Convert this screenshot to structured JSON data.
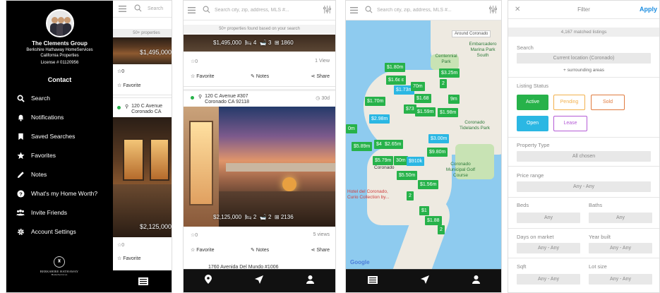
{
  "panel1": {
    "agent_name": "The Clements Group",
    "agent_sub1": "Berkshire Hathaway HomeServices",
    "agent_sub2": "California Properties",
    "license": "License # 01120956",
    "contact_label": "Contact",
    "menu_items": [
      {
        "label": "Search",
        "icon": "search-icon"
      },
      {
        "label": "Notifications",
        "icon": "bell-icon"
      },
      {
        "label": "Saved Searches",
        "icon": "bookmark-icon"
      },
      {
        "label": "Favorites",
        "icon": "star-icon"
      },
      {
        "label": "Notes",
        "icon": "pencil-icon"
      },
      {
        "label": "What's my Home Worth?",
        "icon": "question-icon"
      },
      {
        "label": "Invite Friends",
        "icon": "people-icon"
      },
      {
        "label": "Account Settings",
        "icon": "gear-icon"
      }
    ],
    "logo_text": "BERKSHIRE HATHAWAY",
    "logo_sub": "HomeServices",
    "search_placeholder": "Search",
    "found_text": "50+ properties",
    "price_top": "$1,495,000",
    "favorite_count": "0",
    "favorite_label": "Favorite",
    "address_line1": "120 C Avenue",
    "address_line2": "Coronado CA",
    "price_mid": "$2,125,000",
    "favorite_count2": "0",
    "favorite_label2": "Favorite"
  },
  "panel2": {
    "search_placeholder": "Search city, zip, address, MLS #...",
    "found_text": "50+ properties found based on your search",
    "listing1": {
      "price": "$1,495,000",
      "beds": "4",
      "baths": "3",
      "sqft": "1860",
      "favorites": "0",
      "views": "1 View"
    },
    "actions": {
      "favorite": "Favorite",
      "notes": "Notes",
      "share": "Share"
    },
    "listing2": {
      "address_line1": "120 C Avenue #307",
      "address_line2": "Coronado CA 92118",
      "days": "30d",
      "price": "$2,125,000",
      "beds": "2",
      "baths": "2",
      "sqft": "2136",
      "favorites": "0",
      "views": "5 views"
    },
    "listing3_address": "1760 Avenida Del Mundo #1006"
  },
  "panel3": {
    "search_placeholder": "Search city, zip, address, MLS #...",
    "around_label": "Around Coronado",
    "place_labels": [
      "Embarcadero Marina Park South",
      "Centennial Park",
      "Coronado Tidelands Park",
      "Coronado",
      "Coronado Municipal Golf Course",
      "Hotel del Coronado, Curio Collection by..."
    ],
    "markers": [
      {
        "label": "$1.80m",
        "color": "green"
      },
      {
        "label": "$1.6ɛ ɛ",
        "color": "green"
      },
      {
        "label": "$3.25m",
        "color": "green"
      },
      {
        "label": "$1.73m",
        "color": "blue"
      },
      {
        "label": "70m",
        "color": "green"
      },
      {
        "label": "2",
        "color": "green"
      },
      {
        "label": "$1.70m",
        "color": "green"
      },
      {
        "label": "$1.68",
        "color": "green"
      },
      {
        "label": "9m",
        "color": "green"
      },
      {
        "label": "$73",
        "color": "green"
      },
      {
        "label": "$1.59m",
        "color": "green"
      },
      {
        "label": "$1.98m",
        "color": "green"
      },
      {
        "label": "$2.98m",
        "color": "blue"
      },
      {
        "label": "0m",
        "color": "green"
      },
      {
        "label": "$3.00m",
        "color": "blue"
      },
      {
        "label": "$5.89m",
        "color": "green"
      },
      {
        "label": "$4",
        "color": "green"
      },
      {
        "label": "$2.65m",
        "color": "green"
      },
      {
        "label": "$9.80m",
        "color": "green"
      },
      {
        "label": "$5.79m",
        "color": "green"
      },
      {
        "label": "30m",
        "color": "green"
      },
      {
        "label": "$910k",
        "color": "blue"
      },
      {
        "label": "$5.50m",
        "color": "green"
      },
      {
        "label": "$1.56m",
        "color": "green"
      },
      {
        "label": "2",
        "color": "green"
      },
      {
        "label": "$1",
        "color": "green"
      },
      {
        "label": "$1.88",
        "color": "green"
      },
      {
        "label": "2",
        "color": "green"
      }
    ],
    "google_label": "Google"
  },
  "panel4": {
    "title": "Filter",
    "apply": "Apply",
    "matched": "4,167 matched listings",
    "search_label": "Search",
    "search_value": "Current location (Coronado)",
    "surrounding": "+ surrounding areas",
    "status_label": "Listing Status",
    "statuses": [
      "Active",
      "Pending",
      "Sold",
      "Open",
      "Lease"
    ],
    "property_type_label": "Property Type",
    "property_type_value": "All chosen",
    "price_label": "Price range",
    "price_value": "Any - Any",
    "beds_label": "Beds",
    "beds_value": "Any",
    "baths_label": "Baths",
    "baths_value": "Any",
    "dom_label": "Days on market",
    "dom_value": "Any - Any",
    "year_label": "Year built",
    "year_value": "Any - Any",
    "sqft_label": "Sqft",
    "sqft_value": "Any - Any",
    "lot_label": "Lot size",
    "lot_value": "Any - Any"
  },
  "colors": {
    "green": "#27b24a",
    "blue": "#2bb7e3",
    "pending": "#f2b04c",
    "sold": "#e07b3e",
    "lease": "#b45bd6",
    "apply": "#1d8ee0"
  }
}
